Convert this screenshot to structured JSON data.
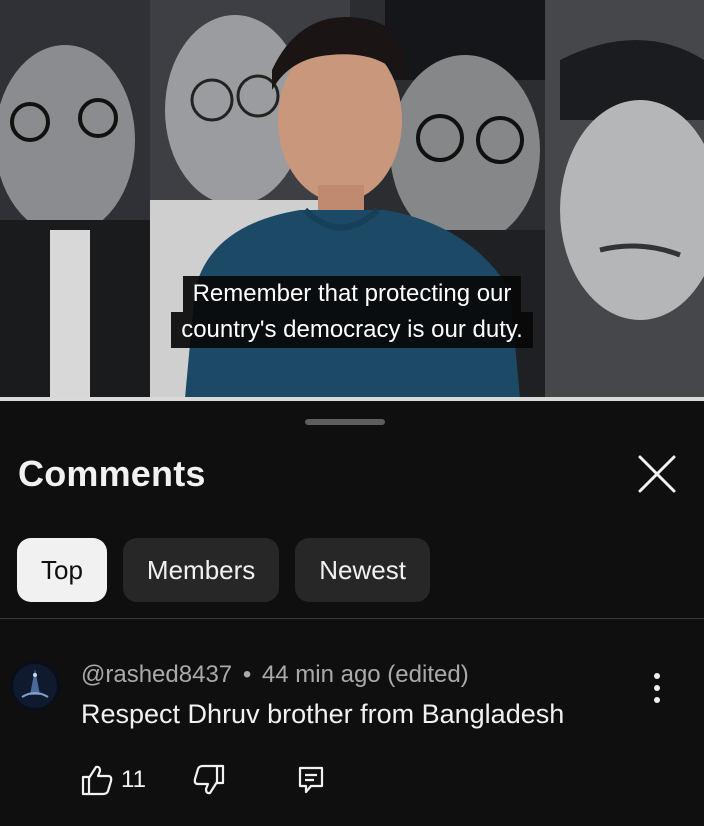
{
  "video": {
    "caption_lines": [
      "Remember that protecting our",
      "country's democracy is our duty."
    ]
  },
  "comments_sheet": {
    "title": "Comments",
    "filters": [
      "Top",
      "Members",
      "Newest"
    ],
    "active_filter": "Top"
  },
  "comment": {
    "author": "@rashed8437",
    "separator": "•",
    "time": "44 min ago (edited)",
    "text": "Respect Dhruv brother from Bangladesh",
    "like_count": "11"
  },
  "icons": {
    "close": "close-icon",
    "more": "more-vertical-icon",
    "like": "thumbs-up-icon",
    "dislike": "thumbs-down-icon",
    "reply": "reply-icon"
  },
  "colors": {
    "background": "#0f0f0f",
    "chip": "#272727",
    "chip_active": "#f1f1f1",
    "text_primary": "#f1f1f1",
    "text_secondary": "#aaaaaa"
  }
}
